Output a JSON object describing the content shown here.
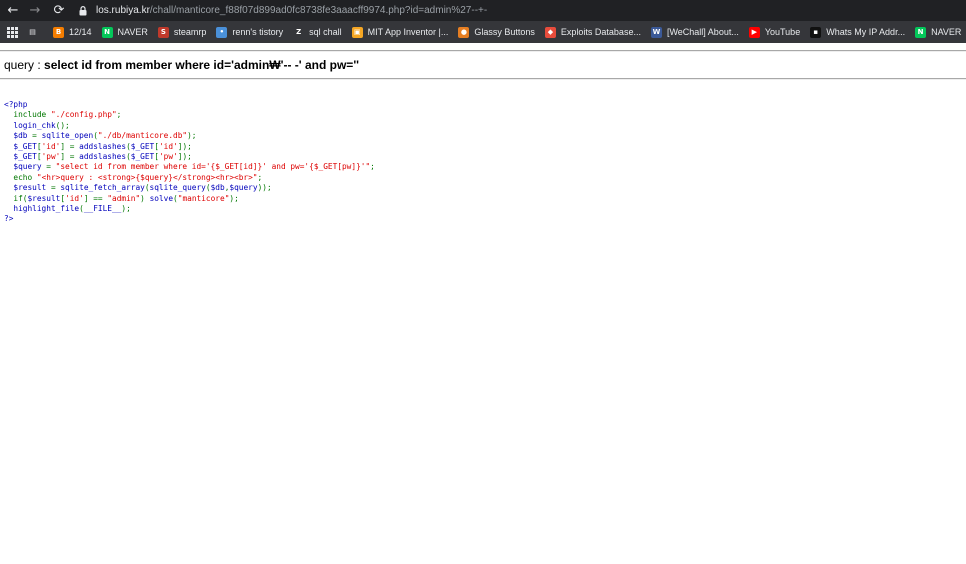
{
  "browser": {
    "url_host": "los.rubiya.kr",
    "url_path": "/chall/manticore_f88f07d899ad0fc8738fe3aaacff9974.php?id=admin%27--+-",
    "bookmarks": [
      {
        "label": "",
        "icon": "apps-grid-icon",
        "color": "#e8eaed"
      },
      {
        "label": "",
        "icon": "page-icon",
        "color": "#9aa0a6"
      },
      {
        "label": "12/14",
        "icon": "blogger-icon",
        "color": "#f57d00"
      },
      {
        "label": "NAVER",
        "icon": "naver-icon",
        "color": "#03c75a"
      },
      {
        "label": "steamrp",
        "icon": "steam-icon",
        "color": "#c0392b"
      },
      {
        "label": "renn's tistory",
        "icon": "tistory-icon",
        "color": "#4a90d9"
      },
      {
        "label": "sql chall",
        "icon": "z-icon",
        "color": "#ffffff"
      },
      {
        "label": "MIT App Inventor |...",
        "icon": "mit-icon",
        "color": "#f5a623"
      },
      {
        "label": "Glassy Buttons",
        "icon": "glassy-icon",
        "color": "#e67e22"
      },
      {
        "label": "Exploits Database...",
        "icon": "exploitdb-icon",
        "color": "#e74c3c"
      },
      {
        "label": "[WeChall] About...",
        "icon": "wechall-icon",
        "color": "#3b5998"
      },
      {
        "label": "YouTube",
        "icon": "youtube-icon",
        "color": "#ff0000"
      },
      {
        "label": "Whats My IP Addr...",
        "icon": "ip-icon",
        "color": "#111111"
      },
      {
        "label": "NAVER",
        "icon": "naver-icon",
        "color": "#03c75a"
      }
    ]
  },
  "page": {
    "query_prefix": "query : ",
    "query_text": "select id from member where id='admin₩'-- -' and pw=''",
    "source_lines": [
      [
        [
          "def",
          "<?php"
        ]
      ],
      [
        [
          "def",
          "  "
        ],
        [
          "kw",
          "include "
        ],
        [
          "str",
          "\"./config.php\""
        ],
        [
          "kw",
          ";"
        ]
      ],
      [
        [
          "def",
          "  login_chk"
        ],
        [
          "kw",
          "();"
        ]
      ],
      [
        [
          "def",
          "  $db "
        ],
        [
          "kw",
          "= "
        ],
        [
          "def",
          "sqlite_open"
        ],
        [
          "kw",
          "("
        ],
        [
          "str",
          "\"./db/manticore.db\""
        ],
        [
          "kw",
          ");"
        ]
      ],
      [
        [
          "def",
          "  $_GET"
        ],
        [
          "kw",
          "["
        ],
        [
          "str",
          "'id'"
        ],
        [
          "kw",
          "] = "
        ],
        [
          "def",
          "addslashes"
        ],
        [
          "kw",
          "("
        ],
        [
          "def",
          "$_GET"
        ],
        [
          "kw",
          "["
        ],
        [
          "str",
          "'id'"
        ],
        [
          "kw",
          "]);"
        ]
      ],
      [
        [
          "def",
          "  $_GET"
        ],
        [
          "kw",
          "["
        ],
        [
          "str",
          "'pw'"
        ],
        [
          "kw",
          "] = "
        ],
        [
          "def",
          "addslashes"
        ],
        [
          "kw",
          "("
        ],
        [
          "def",
          "$_GET"
        ],
        [
          "kw",
          "["
        ],
        [
          "str",
          "'pw'"
        ],
        [
          "kw",
          "]);"
        ]
      ],
      [
        [
          "def",
          "  $query "
        ],
        [
          "kw",
          "= "
        ],
        [
          "str",
          "\"select id from member where id='{$_GET[id]}' and pw='{$_GET[pw]}'\""
        ],
        [
          "kw",
          ";"
        ]
      ],
      [
        [
          "def",
          "  "
        ],
        [
          "kw",
          "echo "
        ],
        [
          "str",
          "\"<hr>query : <strong>{$query}</strong><hr><br>\""
        ],
        [
          "kw",
          ";"
        ]
      ],
      [
        [
          "def",
          "  $result "
        ],
        [
          "kw",
          "= "
        ],
        [
          "def",
          "sqlite_fetch_array"
        ],
        [
          "kw",
          "("
        ],
        [
          "def",
          "sqlite_query"
        ],
        [
          "kw",
          "("
        ],
        [
          "def",
          "$db"
        ],
        [
          "kw",
          ","
        ],
        [
          "def",
          "$query"
        ],
        [
          "kw",
          "));"
        ]
      ],
      [
        [
          "def",
          "  "
        ],
        [
          "kw",
          "if("
        ],
        [
          "def",
          "$result"
        ],
        [
          "kw",
          "["
        ],
        [
          "str",
          "'id'"
        ],
        [
          "kw",
          "] == "
        ],
        [
          "str",
          "\"admin\""
        ],
        [
          "kw",
          ") "
        ],
        [
          "def",
          "solve"
        ],
        [
          "kw",
          "("
        ],
        [
          "str",
          "\"manticore\""
        ],
        [
          "kw",
          ");"
        ]
      ],
      [
        [
          "def",
          "  highlight_file"
        ],
        [
          "kw",
          "("
        ],
        [
          "def",
          "__FILE__"
        ],
        [
          "kw",
          ");"
        ]
      ],
      [
        [
          "def",
          "?>"
        ]
      ]
    ]
  }
}
